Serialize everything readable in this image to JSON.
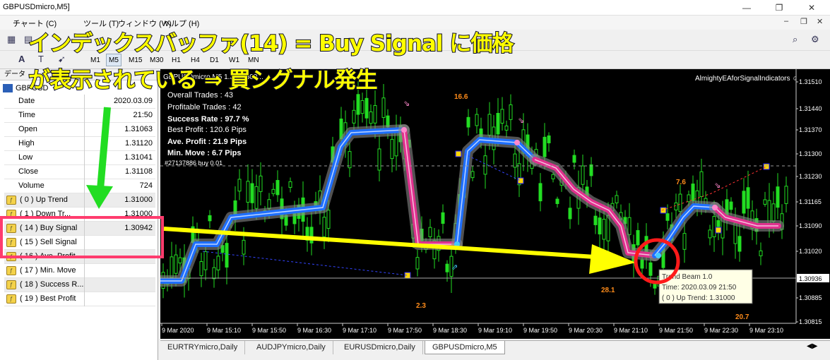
{
  "window": {
    "title": "GBPUSDmicro,M5]",
    "controls": [
      "—",
      "❐",
      "✕"
    ]
  },
  "menu": [
    "チャート (C)",
    "ツール (T)",
    "ウィンドウ (W)",
    "ヘルプ (H)"
  ],
  "timeframes": [
    "M1",
    "M5",
    "M15",
    "M30",
    "H1",
    "H4",
    "D1",
    "W1",
    "MN"
  ],
  "active_timeframe": "M5",
  "data_window": {
    "header": "データ",
    "symbol": "GBPUSD",
    "rows": [
      {
        "label": "Date",
        "value": "2020.03.09"
      },
      {
        "label": "Time",
        "value": "21:50"
      },
      {
        "label": "Open",
        "value": "1.31063"
      },
      {
        "label": "High",
        "value": "1.31120"
      },
      {
        "label": "Low",
        "value": "1.31041"
      },
      {
        "label": "Close",
        "value": "1.31108"
      },
      {
        "label": "Volume",
        "value": "724"
      },
      {
        "label": "( 0 ) Up Trend",
        "value": "1.31000"
      },
      {
        "label": "( 1 ) Down Tr...",
        "value": "1.31000"
      },
      {
        "label": "( 14 ) Buy Signal",
        "value": "1.30942"
      },
      {
        "label": "( 15 ) Sell  Signal",
        "value": ""
      },
      {
        "label": "( 16 ) Ave. Profit",
        "value": ""
      },
      {
        "label": "( 17 ) Min. Move",
        "value": ""
      },
      {
        "label": "( 18 ) Success R...",
        "value": ""
      },
      {
        "label": "( 19 ) Best Profit",
        "value": ""
      }
    ]
  },
  "chart": {
    "header": "GBPUSDmicro,M5  1.31...  309...",
    "ea_name": "AlmightyEAforSignalIndicators ☺",
    "stats": {
      "overall_trades": "Overall Trades :  43",
      "profitable_trades": "Profitable Trades :  42",
      "success_rate": "Success Rate :  97.7 %",
      "best_profit": "Best Profit :  120.6 Pips",
      "ave_profit": "Ave. Profit :  21.9 Pips",
      "min_move": "Min. Move :  6.7 Pips",
      "order": "#27137886 buy 0.01"
    },
    "price_labels": [
      "1.31510",
      "1.31440",
      "1.31370",
      "1.31300",
      "1.31230",
      "1.31165",
      "1.31090",
      "1.31020",
      "1.30936",
      "1.30885",
      "1.30815"
    ],
    "current_price": "1.30936",
    "time_labels": [
      "9 Mar 2020",
      "9 Mar 15:10",
      "9 Mar 15:50",
      "9 Mar 16:30",
      "9 Mar 17:10",
      "9 Mar 17:50",
      "9 Mar 18:30",
      "9 Mar 19:10",
      "9 Mar 19:50",
      "9 Mar 20:30",
      "9 Mar 21:10",
      "9 Mar 21:50",
      "9 Mar 22:30",
      "9 Mar 23:10"
    ],
    "profit_labels": [
      "16.6",
      "7.6",
      "28.1",
      "2.3",
      "20.7"
    ],
    "tooltip": {
      "line1": "Trend Beam 1.0",
      "line2": "Time: 2020.03.09 21:50",
      "line3": "( 0 ) Up Trend: 1.31000"
    },
    "colors": {
      "up": "#1e6fff",
      "down": "#e0318e",
      "candle": "#22dd22",
      "bg": "#000000"
    }
  },
  "tabs": [
    "EURTRYmicro,Daily",
    "AUDJPYmicro,Daily",
    "EURUSDmicro,Daily",
    "GBPUSDmicro,M5"
  ],
  "active_tab": "GBPUSDmicro,M5",
  "annotation": {
    "line1": "インデックスバッファ(14) = Buy Signal に価格",
    "line2": "が表示されている ⇒ 買シグナル発生"
  }
}
